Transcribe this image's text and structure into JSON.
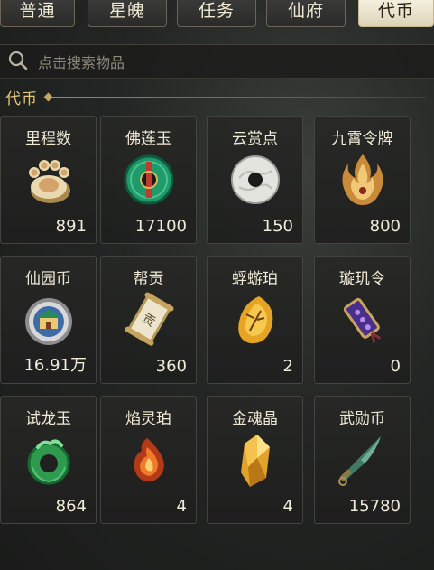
{
  "tabs": [
    {
      "label": "普通",
      "active": false
    },
    {
      "label": "星魄",
      "active": false
    },
    {
      "label": "任务",
      "active": false
    },
    {
      "label": "仙府",
      "active": false
    },
    {
      "label": "代币",
      "active": true
    }
  ],
  "search": {
    "placeholder": "点击搜索物品"
  },
  "section": {
    "title": "代币"
  },
  "items": [
    {
      "name": "里程数",
      "count": "891",
      "icon": "paw-icon"
    },
    {
      "name": "佛莲玉",
      "count": "17100",
      "icon": "jade-ring-icon"
    },
    {
      "name": "云赏点",
      "count": "150",
      "icon": "white-disc-icon"
    },
    {
      "name": "九霄令牌",
      "count": "800",
      "icon": "flame-token-icon"
    },
    {
      "name": "仙园币",
      "count": "16.91万",
      "icon": "coin-icon"
    },
    {
      "name": "帮贡",
      "count": "360",
      "icon": "scroll-icon"
    },
    {
      "name": "蜉蝣珀",
      "count": "2",
      "icon": "amber-icon"
    },
    {
      "name": "璇玑令",
      "count": "0",
      "icon": "purple-token-icon"
    },
    {
      "name": "试龙玉",
      "count": "864",
      "icon": "dragon-jade-icon"
    },
    {
      "name": "焰灵珀",
      "count": "4",
      "icon": "fire-stone-icon"
    },
    {
      "name": "金魂晶",
      "count": "4",
      "icon": "gold-crystal-icon"
    },
    {
      "name": "武勋币",
      "count": "15780",
      "icon": "blade-coin-icon"
    }
  ]
}
